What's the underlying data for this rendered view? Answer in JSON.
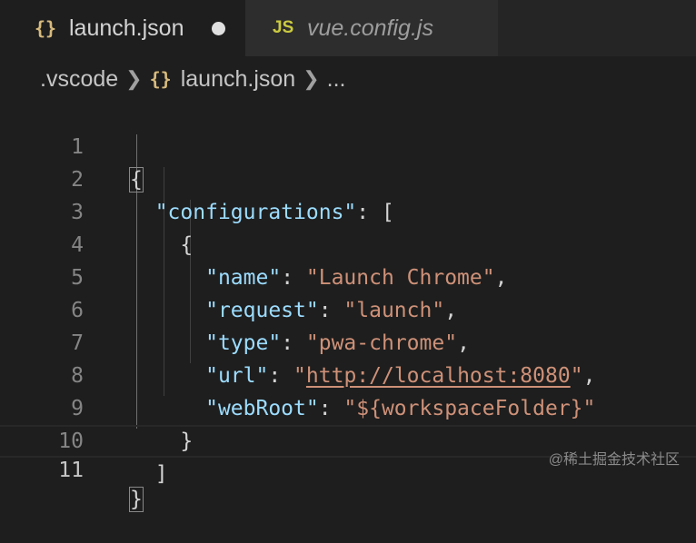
{
  "tabs": [
    {
      "icon": "{}",
      "label": "launch.json",
      "dirty": true
    },
    {
      "icon": "JS",
      "label": "vue.config.js"
    }
  ],
  "breadcrumb": {
    "root": ".vscode",
    "file_icon": "{}",
    "file": "launch.json",
    "more": "..."
  },
  "editor": {
    "line_numbers": [
      "1",
      "2",
      "3",
      "4",
      "5",
      "6",
      "7",
      "8",
      "9",
      "10",
      "11"
    ],
    "lines": {
      "l1": {
        "open": "{"
      },
      "l2": {
        "key": "\"configurations\"",
        "colon": ": ",
        "bracket": "["
      },
      "l3": {
        "open": "{"
      },
      "l4": {
        "key": "\"name\"",
        "colon": ": ",
        "value": "\"Launch Chrome\"",
        "comma": ","
      },
      "l5": {
        "key": "\"request\"",
        "colon": ": ",
        "value": "\"launch\"",
        "comma": ","
      },
      "l6": {
        "key": "\"type\"",
        "colon": ": ",
        "value": "\"pwa-chrome\"",
        "comma": ","
      },
      "l7": {
        "key": "\"url\"",
        "colon": ": ",
        "q1": "\"",
        "url": "http://localhost:8080",
        "q2": "\"",
        "comma": ","
      },
      "l8": {
        "key": "\"webRoot\"",
        "colon": ": ",
        "value": "\"${workspaceFolder}\""
      },
      "l9": {
        "close": "}"
      },
      "l10": {
        "close": "]"
      },
      "l11": {
        "close": "}"
      }
    }
  },
  "watermark": "@稀土掘金技术社区"
}
